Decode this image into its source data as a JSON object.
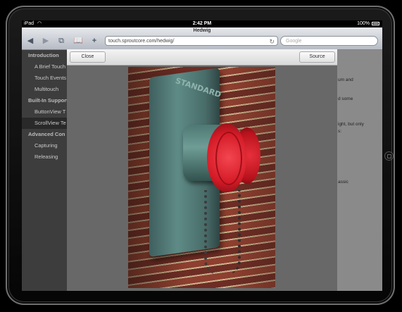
{
  "device": {
    "name": "iPad"
  },
  "status_bar": {
    "carrier": "iPad",
    "time": "2:42 PM",
    "battery": "100%"
  },
  "browser": {
    "page_title": "Hedwig",
    "url": "touch.sproutcore.com/hedwig/",
    "search_placeholder": "Google"
  },
  "toolbar_icons": {
    "back": "back-arrow-icon",
    "forward": "forward-arrow-icon",
    "pages": "pages-icon",
    "bookmarks": "bookmarks-icon",
    "add": "plus-icon",
    "reload": "reload-icon"
  },
  "sidebar": {
    "items": [
      {
        "label": "Introduction",
        "kind": "header"
      },
      {
        "label": "A Brief Touch",
        "kind": "item"
      },
      {
        "label": "Touch Events",
        "kind": "item"
      },
      {
        "label": "Multitouch",
        "kind": "item"
      },
      {
        "label": "Built-In Support",
        "kind": "header"
      },
      {
        "label": "ButtonView T",
        "kind": "item"
      },
      {
        "label": "ScrollView Te",
        "kind": "item",
        "selected": true
      },
      {
        "label": "Advanced Con",
        "kind": "header"
      },
      {
        "label": "Capturing",
        "kind": "item"
      },
      {
        "label": "Releasing",
        "kind": "item"
      }
    ]
  },
  "content_fragments": [
    "um and",
    "d some",
    "ight, but only",
    "s:",
    "assic"
  ],
  "modal": {
    "close_label": "Close",
    "source_label": "Source"
  },
  "photo": {
    "plate_text": "STANDARD"
  }
}
